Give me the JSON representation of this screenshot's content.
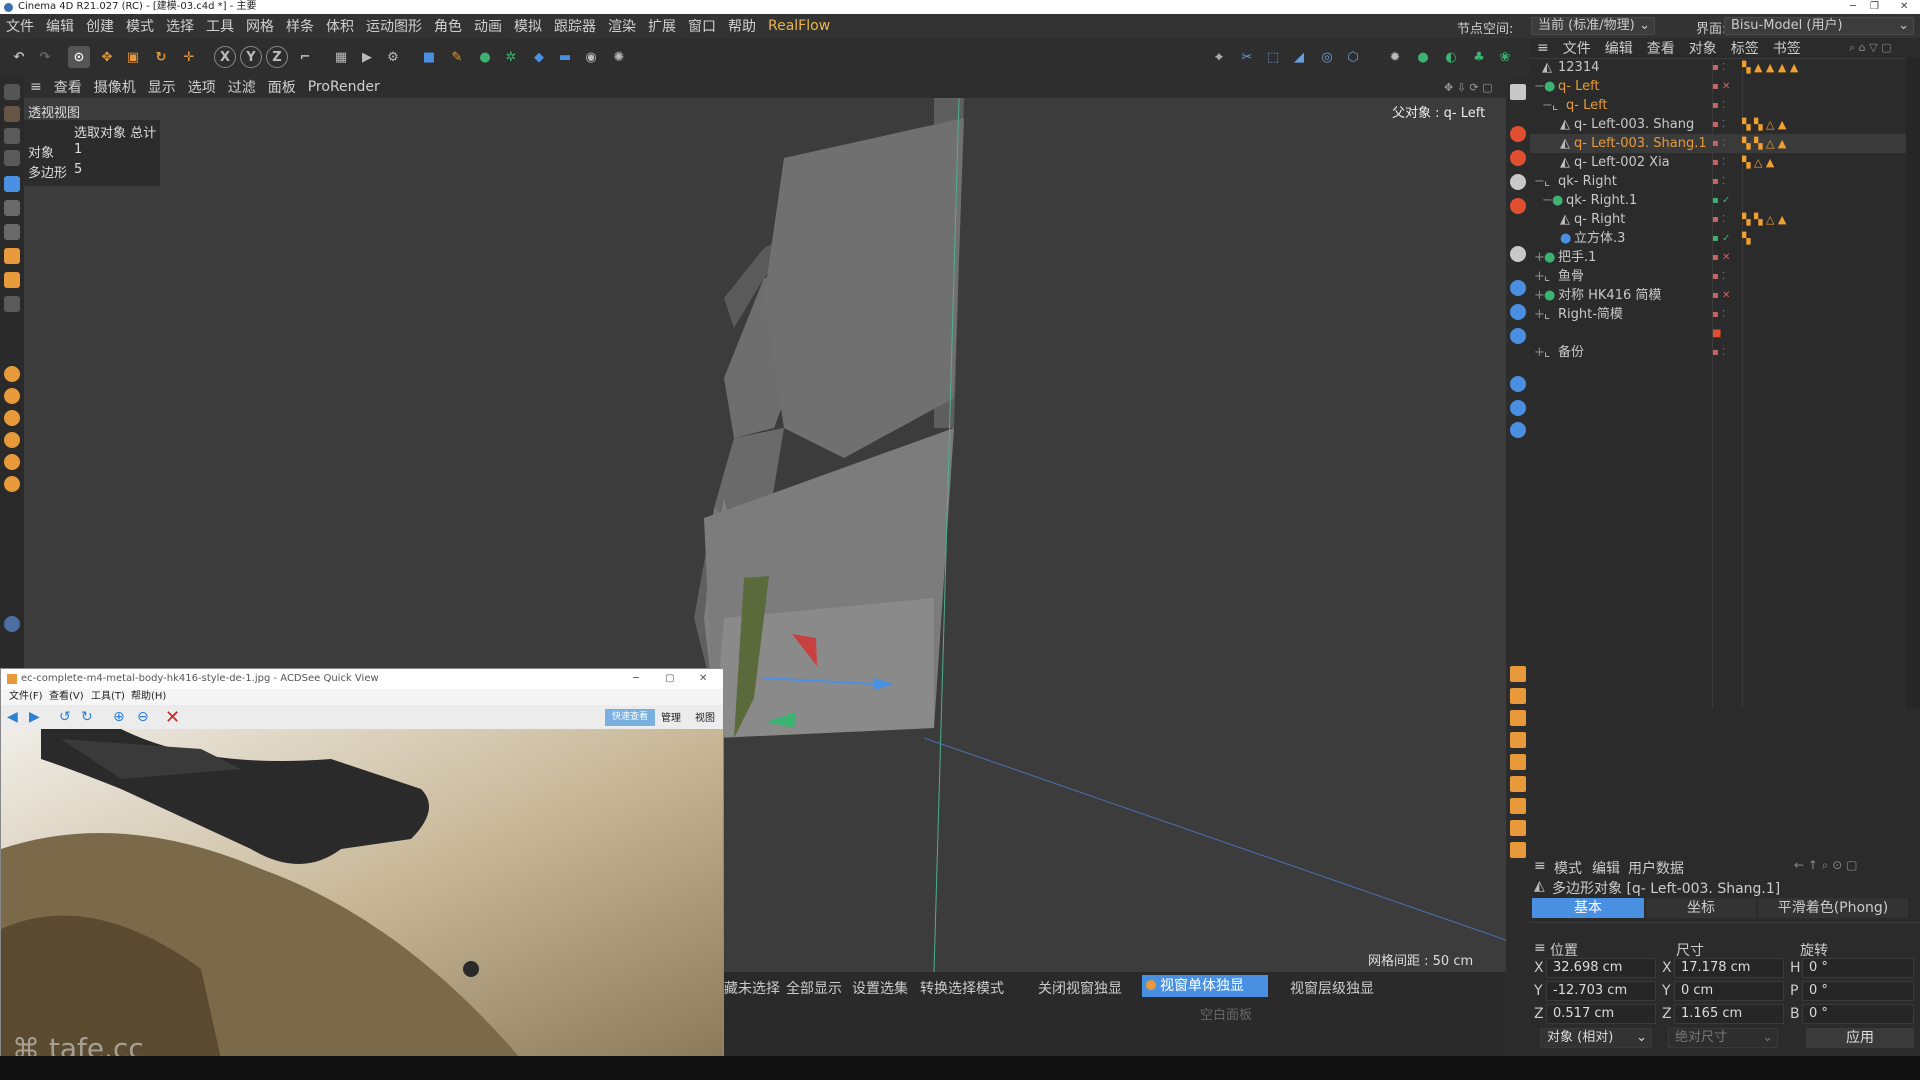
{
  "titlebar": {
    "text": "Cinema 4D R21.027 (RC) - [建模-03.c4d *] - 主要"
  },
  "menu": [
    "文件",
    "编辑",
    "创建",
    "模式",
    "选择",
    "工具",
    "网格",
    "样条",
    "体积",
    "运动图形",
    "角色",
    "动画",
    "模拟",
    "跟踪器",
    "渲染",
    "扩展",
    "窗口",
    "帮助",
    "RealFlow"
  ],
  "node_space": {
    "label": "节点空间:",
    "value": "当前 (标准/物理)"
  },
  "interface": {
    "label": "界面:",
    "value": "Bisu-Model (用户)"
  },
  "viewport_menu": [
    "查看",
    "摄像机",
    "显示",
    "选项",
    "过滤",
    "面板",
    "ProRender"
  ],
  "viewport": {
    "title": "透视视图",
    "parent_label": "父对象 : q- Left",
    "grid_spacing": "网格间距 : 50 cm"
  },
  "stats": {
    "header": "选取对象 总计",
    "obj_label": "对象",
    "obj_value": "1",
    "poly_label": "多边形",
    "poly_value": "5"
  },
  "bottom_buttons": [
    "藏未选择",
    "全部显示",
    "设置选集",
    "转换选择模式",
    "关闭视窗独显",
    "视窗单体独显",
    "视窗层级独显"
  ],
  "empty_panel": "空白面板",
  "obj_menu": [
    "文件",
    "编辑",
    "查看",
    "对象",
    "标签",
    "书签"
  ],
  "objects": [
    {
      "name": "12314",
      "color": "#c8c8c8",
      "icon": "polygon-icon"
    },
    {
      "name": "q- Left",
      "color": "#e89a3a",
      "icon": "null-icon"
    },
    {
      "name": "q- Left",
      "color": "#e89a3a",
      "icon": "null-icon"
    },
    {
      "name": "q- Left-003. Shang",
      "color": "#c8c8c8",
      "icon": "polygon-icon"
    },
    {
      "name": "q- Left-003. Shang.1",
      "color": "#e89a3a",
      "icon": "polygon-icon"
    },
    {
      "name": "q- Left-002 Xia",
      "color": "#c8c8c8",
      "icon": "polygon-icon"
    },
    {
      "name": "qk- Right",
      "color": "#c8c8c8",
      "icon": "null-icon"
    },
    {
      "name": "qk- Right.1",
      "color": "#c8c8c8",
      "icon": "symmetry-icon"
    },
    {
      "name": "q- Right",
      "color": "#c8c8c8",
      "icon": "polygon-icon"
    },
    {
      "name": "立方体.3",
      "color": "#c8c8c8",
      "icon": "cube-icon"
    },
    {
      "name": "把手.1",
      "color": "#c8c8c8",
      "icon": "symmetry-icon"
    },
    {
      "name": "鱼骨",
      "color": "#c8c8c8",
      "icon": "null-icon"
    },
    {
      "name": "对称 HK416 简模",
      "color": "#c8c8c8",
      "icon": "symmetry-icon"
    },
    {
      "name": "Right-简模",
      "color": "#c8c8c8",
      "icon": "null-icon"
    },
    {
      "name": "",
      "color": "#c8c8c8",
      "icon": ""
    },
    {
      "name": "备份",
      "color": "#c8c8c8",
      "icon": "null-icon"
    }
  ],
  "attr": {
    "menu": [
      "模式",
      "编辑",
      "用户数据"
    ],
    "object_title": "多边形对象 [q- Left-003. Shang.1]",
    "tabs": [
      "基本",
      "坐标",
      "平滑着色(Phong)"
    ],
    "headers": [
      "位置",
      "尺寸",
      "旋转"
    ],
    "pos": {
      "x": "32.698 cm",
      "y": "-12.703 cm",
      "z": "0.517 cm"
    },
    "size": {
      "x": "17.178 cm",
      "y": "0 cm",
      "z": "1.165 cm"
    },
    "rot": {
      "h": "0 °",
      "p": "0 °",
      "b": "0 °"
    },
    "mode_select": "对象 (相对)",
    "size_select": "绝对尺寸",
    "apply": "应用"
  },
  "acdsee": {
    "title": "ec-complete-m4-metal-body-hk416-style-de-1.jpg - ACDSee Quick View",
    "menu": [
      "文件(F)",
      "查看(V)",
      "工具(T)",
      "帮助(H)"
    ],
    "buttons": [
      "快速查看",
      "管理",
      "视图"
    ]
  },
  "watermark": "tafe.cc"
}
